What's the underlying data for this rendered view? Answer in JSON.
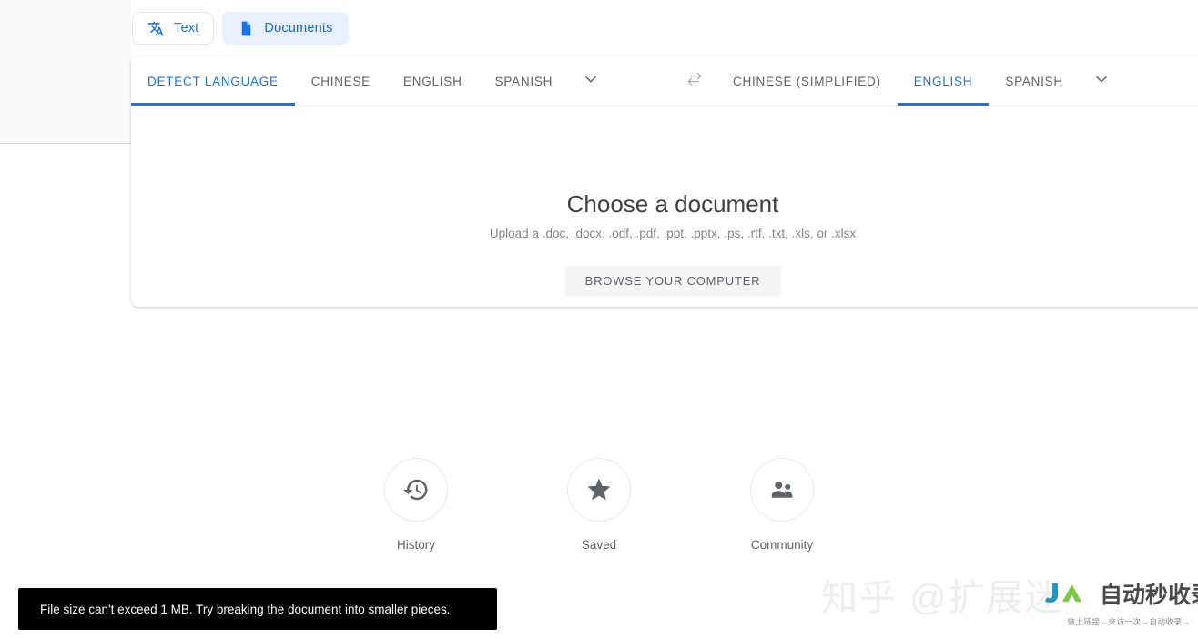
{
  "mode_switch": {
    "text_label": "Text",
    "documents_label": "Documents"
  },
  "source_languages": {
    "tabs": [
      {
        "label": "DETECT LANGUAGE",
        "active": true
      },
      {
        "label": "CHINESE",
        "active": false
      },
      {
        "label": "ENGLISH",
        "active": false
      },
      {
        "label": "SPANISH",
        "active": false
      }
    ],
    "more_icon": "chevron-down-icon"
  },
  "swap_icon": "swap-horizontal-icon",
  "target_languages": {
    "tabs": [
      {
        "label": "CHINESE (SIMPLIFIED)",
        "active": false
      },
      {
        "label": "ENGLISH",
        "active": true
      },
      {
        "label": "SPANISH",
        "active": false
      }
    ],
    "more_icon": "chevron-down-icon"
  },
  "drop_zone": {
    "title": "Choose a document",
    "subtitle": "Upload a .doc, .docx, .odf, .pdf, .ppt, .pptx, .ps, .rtf, .txt, .xls, or .xlsx",
    "browse_button": "BROWSE YOUR COMPUTER"
  },
  "shortcuts": [
    {
      "label": "History",
      "icon": "history-icon"
    },
    {
      "label": "Saved",
      "icon": "star-icon"
    },
    {
      "label": "Community",
      "icon": "people-icon"
    }
  ],
  "toast": {
    "message": "File size can't exceed 1 MB. Try breaking the document into smaller pieces."
  },
  "watermarks": {
    "zhihu": "知乎 @扩展迷",
    "logo_text": "自动秒收录",
    "logo_tagline": "做上链接→来访一次→自动收录→"
  },
  "colors": {
    "accent_blue": "#1a73e8",
    "active_chip_bg": "#e8f0fe",
    "text_secondary": "#5f6368",
    "toast_bg": "#000000"
  }
}
